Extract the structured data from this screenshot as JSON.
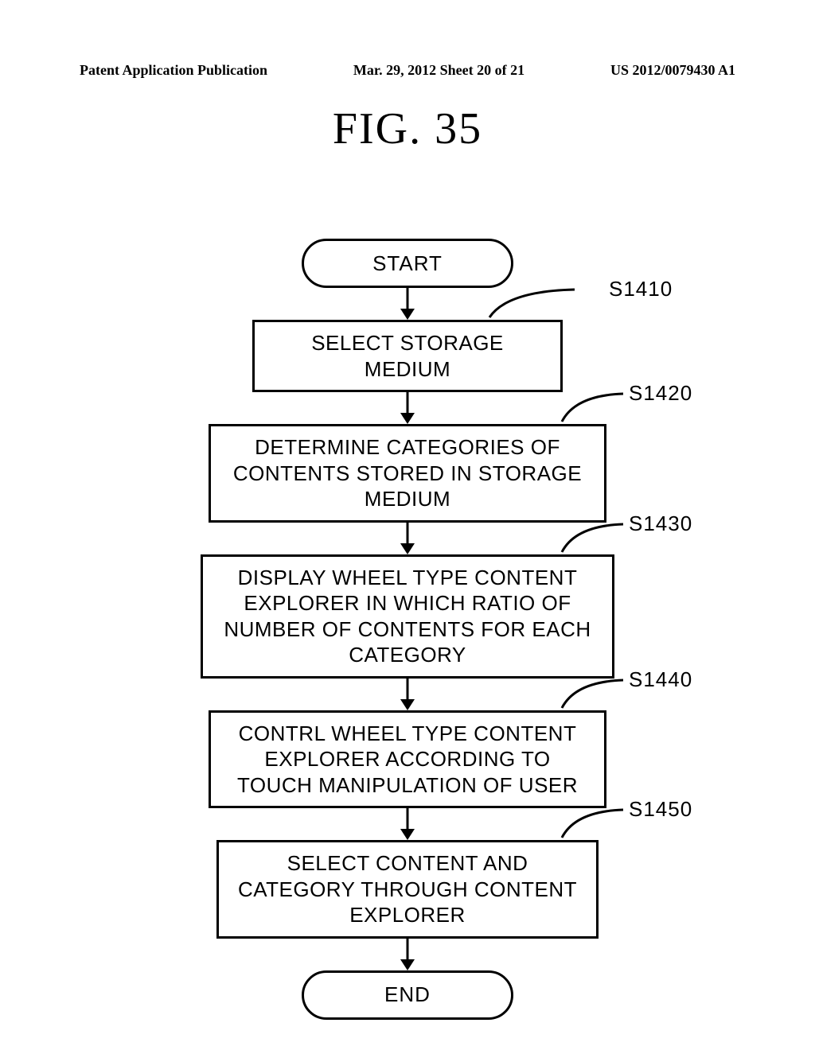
{
  "header": {
    "left": "Patent Application Publication",
    "center": "Mar. 29, 2012  Sheet 20 of 21",
    "right": "US 2012/0079430 A1"
  },
  "figure_title": "FIG. 35",
  "terminators": {
    "start": "START",
    "end": "END"
  },
  "steps": [
    {
      "id": "S1410",
      "text": "SELECT STORAGE MEDIUM"
    },
    {
      "id": "S1420",
      "text": "DETERMINE CATEGORIES OF CONTENTS STORED IN STORAGE MEDIUM"
    },
    {
      "id": "S1430",
      "text": "DISPLAY WHEEL TYPE CONTENT EXPLORER IN WHICH RATIO OF NUMBER OF CONTENTS FOR EACH CATEGORY"
    },
    {
      "id": "S1440",
      "text": "CONTRL WHEEL TYPE CONTENT EXPLORER ACCORDING TO TOUCH MANIPULATION OF USER"
    },
    {
      "id": "S1450",
      "text": "SELECT CONTENT AND CATEGORY THROUGH CONTENT EXPLORER"
    }
  ],
  "chart_data": {
    "type": "table",
    "title": "FIG. 35 flowchart steps",
    "columns": [
      "step_id",
      "description"
    ],
    "rows": [
      [
        "S1410",
        "SELECT STORAGE MEDIUM"
      ],
      [
        "S1420",
        "DETERMINE CATEGORIES OF CONTENTS STORED IN STORAGE MEDIUM"
      ],
      [
        "S1430",
        "DISPLAY WHEEL TYPE CONTENT EXPLORER IN WHICH RATIO OF NUMBER OF CONTENTS FOR EACH CATEGORY"
      ],
      [
        "S1440",
        "CONTRL WHEEL TYPE CONTENT EXPLORER ACCORDING TO TOUCH MANIPULATION OF USER"
      ],
      [
        "S1450",
        "SELECT CONTENT AND CATEGORY THROUGH CONTENT EXPLORER"
      ]
    ]
  }
}
